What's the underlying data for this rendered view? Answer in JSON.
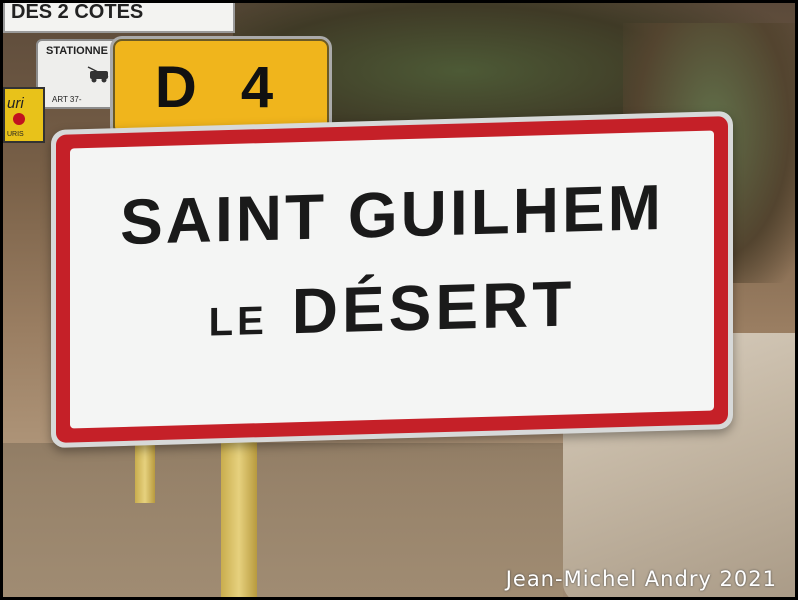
{
  "signs": {
    "top_partial": "DES 2 COTES",
    "parking": {
      "label": "STATIONNE",
      "footnote": "ART 37-"
    },
    "yellow_small": {
      "text": "uri",
      "footnote": "URIS"
    },
    "route": "D 4",
    "town": {
      "line1": "SAINT GUILHEM",
      "line2_small": "LE",
      "line2_large": "DÉSERT"
    }
  },
  "watermark": "Jean-Michel Andry 2021",
  "colors": {
    "sign_red": "#c52028",
    "sign_white": "#f4f5f4",
    "route_yellow": "#f0b51c",
    "text_dark": "#1a1a1a"
  }
}
